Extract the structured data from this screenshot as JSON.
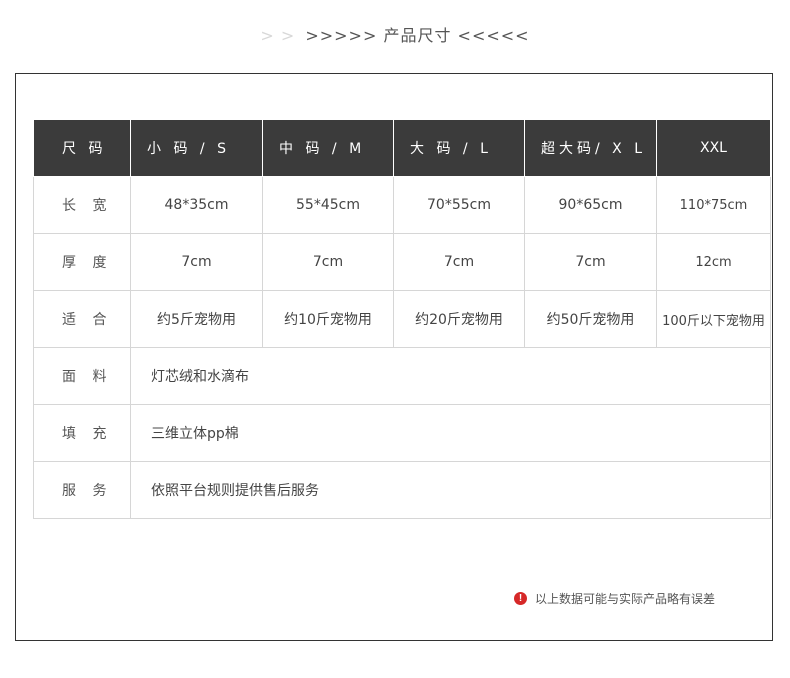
{
  "header": {
    "faint_arrows": "> >",
    "title": ">>>>> 产品尺寸 <<<<<"
  },
  "table": {
    "columns": [
      "尺 码",
      "小 码 / S",
      "中 码 / M",
      "大 码 / L",
      "超大码/ X L",
      "XXL"
    ],
    "size_rows": [
      {
        "label": "长 宽",
        "values": [
          "48*35cm",
          "55*45cm",
          "70*55cm",
          "90*65cm",
          "110*75cm"
        ]
      },
      {
        "label": "厚 度",
        "values": [
          "7cm",
          "7cm",
          "7cm",
          "7cm",
          "12cm"
        ]
      },
      {
        "label": "适 合",
        "values": [
          "约5斤宠物用",
          "约10斤宠物用",
          "约20斤宠物用",
          "约50斤宠物用",
          "100斤以下宠物用"
        ]
      }
    ],
    "info_rows": [
      {
        "label": "面 料",
        "value": "灯芯绒和水滴布"
      },
      {
        "label": "填 充",
        "value": "三维立体pp棉"
      },
      {
        "label": "服 务",
        "value": "依照平台规则提供售后服务"
      }
    ]
  },
  "note": {
    "icon": "exclamation-icon",
    "icon_glyph": "!",
    "text": "以上数据可能与实际产品略有误差",
    "icon_color": "#d62828"
  },
  "colors": {
    "header_bg": "#3b3b3b",
    "border": "#d6d6d6",
    "frame": "#333333"
  }
}
